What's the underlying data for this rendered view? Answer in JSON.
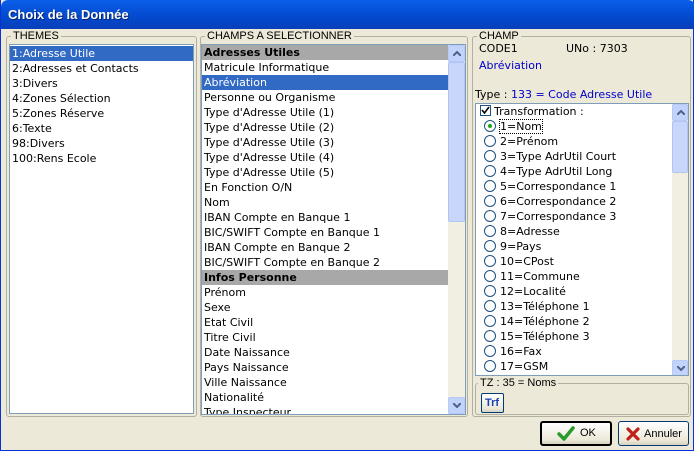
{
  "window": {
    "title": "Choix de la Donnée"
  },
  "themes": {
    "legend": "THEMES",
    "items": [
      "1:Adresse Utile",
      "2:Adresses et Contacts",
      "3:Divers",
      "4:Zones Sélection",
      "5:Zones Réserve",
      "6:Texte",
      "98:Divers",
      "100:Rens Ecole"
    ],
    "selected_index": 0
  },
  "fields": {
    "legend": "CHAMPS A SELECTIONNER",
    "items": [
      {
        "label": "Adresses Utiles",
        "type": "header"
      },
      {
        "label": "Matricule Informatique"
      },
      {
        "label": "Abréviation",
        "selected": true
      },
      {
        "label": "Personne ou Organisme"
      },
      {
        "label": "Type d'Adresse Utile (1)"
      },
      {
        "label": "Type d'Adresse Utile (2)"
      },
      {
        "label": "Type d'Adresse Utile (3)"
      },
      {
        "label": "Type d'Adresse Utile (4)"
      },
      {
        "label": "Type d'Adresse Utile (5)"
      },
      {
        "label": "En Fonction O/N"
      },
      {
        "label": "Nom"
      },
      {
        "label": "IBAN Compte en Banque 1"
      },
      {
        "label": "BIC/SWIFT Compte en Banque 1"
      },
      {
        "label": "IBAN Compte en Banque 2"
      },
      {
        "label": "BIC/SWIFT Compte en Banque 2"
      },
      {
        "label": "Infos Personne",
        "type": "header"
      },
      {
        "label": "Prénom"
      },
      {
        "label": "Sexe"
      },
      {
        "label": "Etat Civil"
      },
      {
        "label": "Titre Civil"
      },
      {
        "label": "Date Naissance"
      },
      {
        "label": "Pays Naissance"
      },
      {
        "label": "Ville Naissance"
      },
      {
        "label": "Nationalité"
      },
      {
        "label": "Type Inspecteur"
      }
    ]
  },
  "champ": {
    "legend": "CHAMP",
    "code": "CODE1",
    "uno": "UNo : 7303",
    "name": "Abréviation",
    "type_prefix": "Type : ",
    "type_value": "133 = Code Adresse Utile",
    "transformation_label": "Transformation :",
    "transformation_checked": true,
    "options": [
      "1=Nom",
      "2=Prénom",
      "3=Type AdrUtil Court",
      "4=Type AdrUtil Long",
      "5=Correspondance 1",
      "6=Correspondance 2",
      "7=Correspondance 3",
      "8=Adresse",
      "9=Pays",
      "10=CPost",
      "11=Commune",
      "12=Localité",
      "13=Téléphone 1",
      "14=Téléphone 2",
      "15=Téléphone 3",
      "16=Fax",
      "17=GSM"
    ],
    "selected_option": 0,
    "tz_text": "TZ : 35 = Noms",
    "trf_button": "Trf"
  },
  "buttons": {
    "ok": "OK",
    "cancel": "Annuler"
  },
  "colors": {
    "selection": "#316ac5",
    "ok_check": "#2a9a2a",
    "cancel_x": "#c0201a",
    "link_blue": "#0000cc"
  }
}
